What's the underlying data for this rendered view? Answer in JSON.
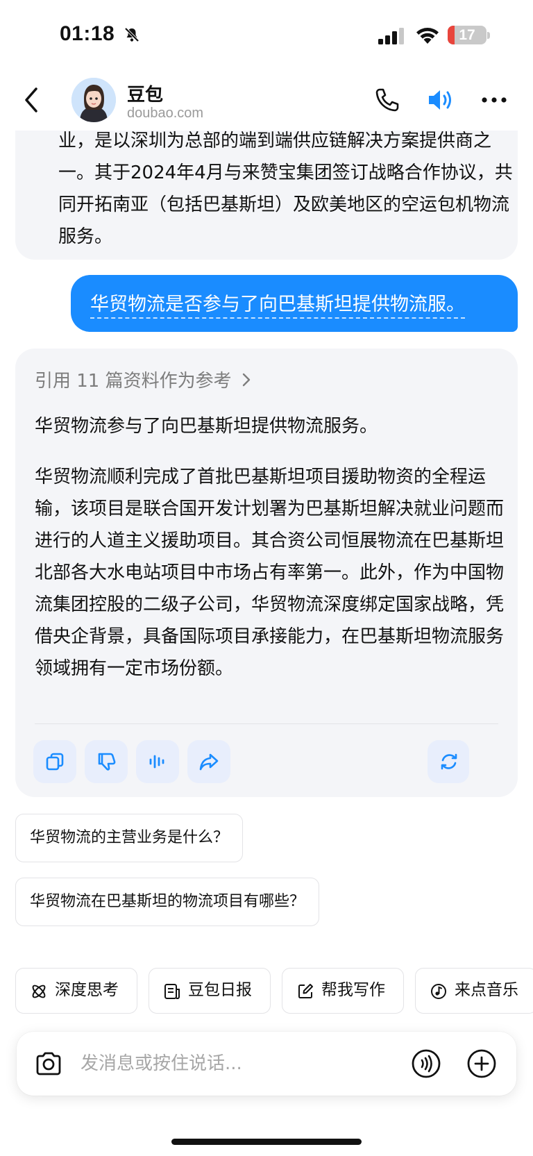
{
  "status_bar": {
    "time": "01:18",
    "battery": "17",
    "battery_color": "#e8453c"
  },
  "header": {
    "name": "豆包",
    "domain": "doubao.com",
    "icons": [
      "back-icon",
      "phone-icon",
      "speaker-icon",
      "more-icon"
    ]
  },
  "prev_message": "业，是以深圳为总部的端到端供应链解决方案提供商之一。其于2024年4月与来赞宝集团签订战略合作协议，共同开拓南亚（包括巴基斯坦）及欧美地区的空运包机物流服务。",
  "user_message": "华贸物流是否参与了向巴基斯坦提供物流服。",
  "answer": {
    "refs_label": "引用 11 篇资料作为参考",
    "summary": "华贸物流参与了向巴基斯坦提供物流服务。",
    "detail": "华贸物流顺利完成了首批巴基斯坦项目援助物资的全程运输，该项目是联合国开发计划署为巴基斯坦解决就业问题而进行的人道主义援助项目。其合资公司恒展物流在巴基斯坦北部各大水电站项目中市场占有率第一。此外，作为中国物流集团控股的二级子公司，华贸物流深度绑定国家战略，凭借央企背景，具备国际项目承接能力，在巴基斯坦物流服务领域拥有一定市场份额。",
    "actions": [
      "copy-icon",
      "dislike-icon",
      "voice-play-icon",
      "share-icon",
      "regenerate-icon"
    ]
  },
  "suggestions": [
    "华贸物流的主营业务是什么？",
    "华贸物流在巴基斯坦的物流项目有哪些？"
  ],
  "chips": [
    "深度思考",
    "豆包日报",
    "帮我写作",
    "来点音乐"
  ],
  "input": {
    "placeholder": "发消息或按住说话..."
  },
  "accent_color": "#1a8cff"
}
